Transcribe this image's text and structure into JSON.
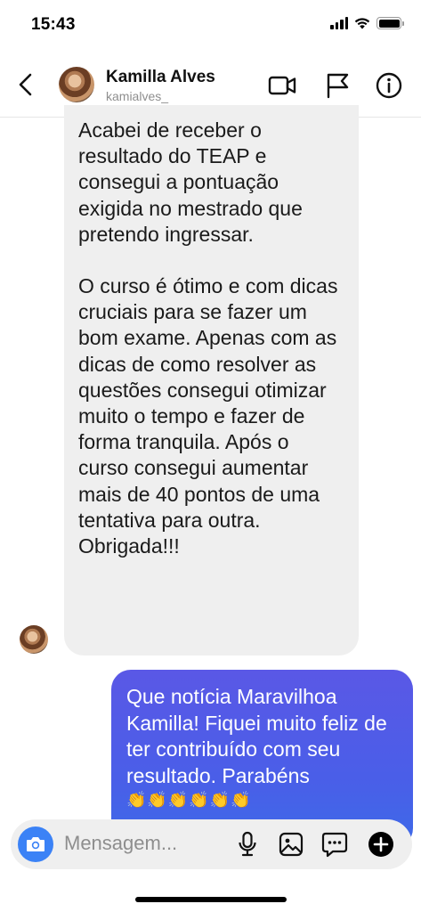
{
  "status_bar": {
    "time": "15:43"
  },
  "header": {
    "contact_name": "Kamilla Alves",
    "contact_handle": "kamialves_"
  },
  "messages": {
    "incoming": {
      "paragraphs": [
        "Acabei de receber o resultado do TEAP e consegui a pontuação exigida no mestrado que pretendo ingressar.",
        "O curso é ótimo e com dicas cruciais para se fazer um bom exame. Apenas com as dicas de como resolver as questões consegui otimizar muito o tempo e fazer de forma tranquila. Após o curso consegui aumentar mais de 40 pontos de uma tentativa para outra. Obrigada!!!"
      ]
    },
    "outgoing": {
      "text": "Que notícia Maravilhoa Kamilla! Fiquei muito feliz de ter contribuído com seu resultado. Parabéns",
      "emoji": "👏👏👏👏👏👏"
    }
  },
  "composer": {
    "placeholder": "Mensagem..."
  },
  "colors": {
    "outgoing_bubble": "#4a5ee8",
    "incoming_bubble": "#efefef",
    "camera_button": "#3b82f6"
  },
  "icons": [
    "back-icon",
    "video-call-icon",
    "flag-icon",
    "info-icon",
    "camera-icon",
    "microphone-icon",
    "gallery-icon",
    "sticker-icon",
    "plus-icon"
  ]
}
